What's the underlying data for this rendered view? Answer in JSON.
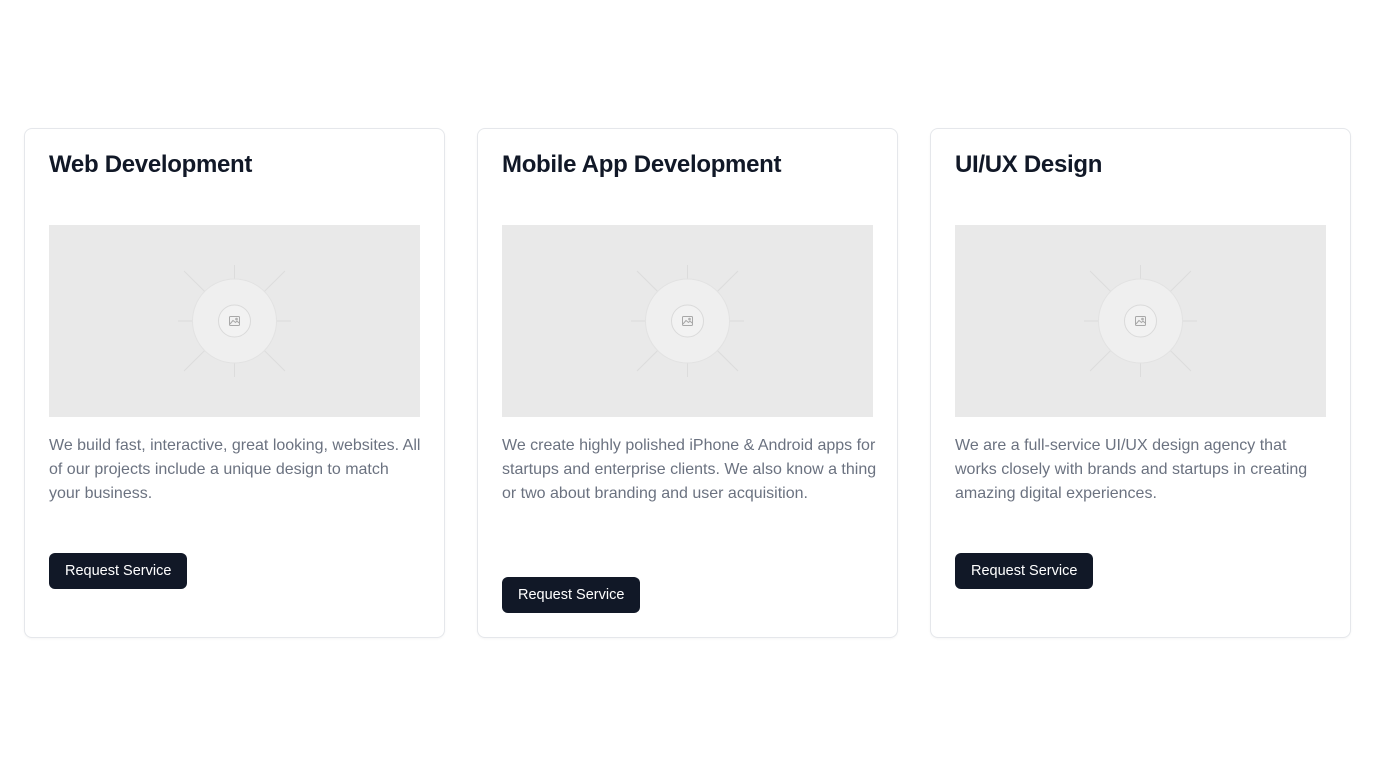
{
  "services": [
    {
      "title": "Web Development",
      "description": "We build fast, interactive, great looking, websites. All of our projects include a unique design to match your business.",
      "button_label": "Request Service",
      "image_icon": "image-placeholder-icon"
    },
    {
      "title": "Mobile App Development",
      "description": "We create highly polished iPhone & Android apps for startups and enterprise clients. We also know a thing or two about branding and user acquisition.",
      "button_label": "Request Service",
      "image_icon": "image-placeholder-icon"
    },
    {
      "title": "UI/UX Design",
      "description": "We are a full-service UI/UX design agency that works closely with brands and startups in creating amazing digital experiences.",
      "button_label": "Request Service",
      "image_icon": "image-placeholder-icon"
    }
  ],
  "colors": {
    "button_bg": "#111827",
    "title": "#111827",
    "description": "#6b7280",
    "placeholder_bg": "#e9e9e9",
    "card_border": "#e5e7eb"
  }
}
